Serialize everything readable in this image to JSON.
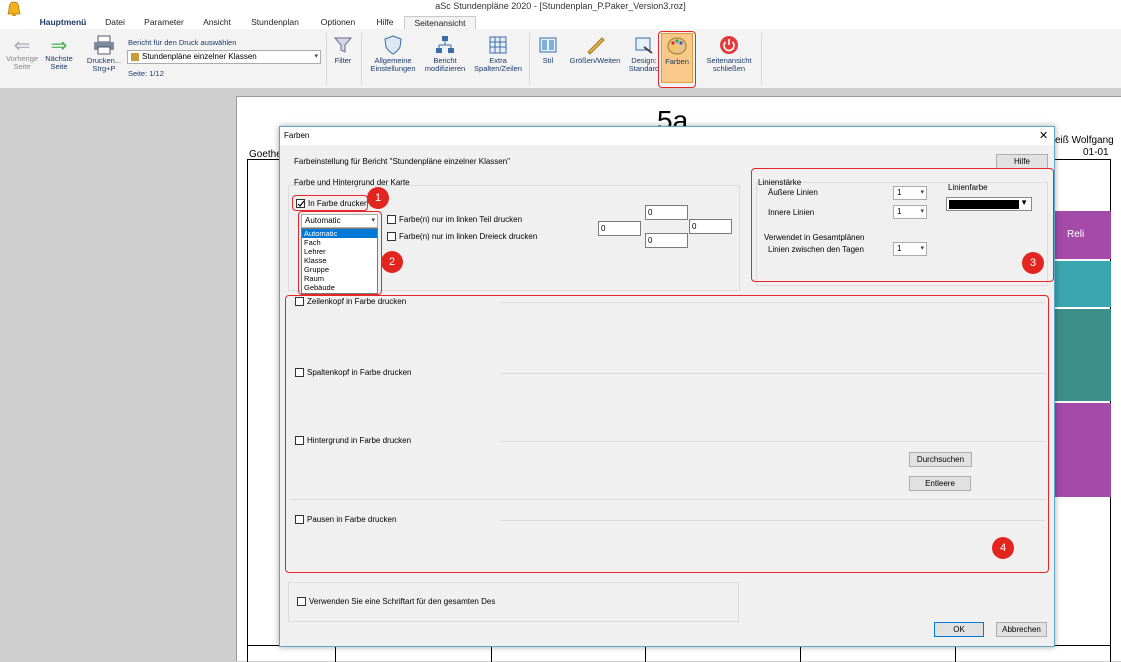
{
  "window": {
    "title": "aSc Stundenpläne 2020  - [Stundenplan_P.Paker_Version3.roz]"
  },
  "menu": {
    "tabs": [
      "Hauptmenü",
      "Datei",
      "Parameter",
      "Ansicht",
      "Stundenplan",
      "Optionen",
      "Hilfe",
      "Seitenansicht"
    ]
  },
  "ribbon": {
    "prev_label1": "Vorherige",
    "prev_label2": "Seite",
    "next_label1": "Nächste",
    "next_label2": "Seite",
    "print_label1": "Drucken...",
    "print_label2": "Strg+P",
    "report_caption": "Bericht für den Druck auswählen",
    "report_value": "Stundenpläne einzelner Klassen",
    "page_indicator": "Seite: 1/12",
    "filter": "Filter",
    "general1": "Allgemeine",
    "general2": "Einstellungen",
    "modify1": "Bericht",
    "modify2": "modifizieren",
    "extra1": "Extra",
    "extra2": "Spalten/Zeilen",
    "style": "Stil",
    "sizes": "Größen/Weiten",
    "design1": "Design:",
    "design2": "Standard",
    "colors": "Farben",
    "close1": "Seitenansicht",
    "close2": "schließen"
  },
  "page": {
    "heading": "5a",
    "left_text": "Goethe",
    "right_text": "eiß Wolfgang",
    "right_sub": "01-01",
    "cell_text": "Reli"
  },
  "dialog": {
    "title": "Farben",
    "close_symbol": "✕",
    "report_info": "Farbeinstellung für Bericht \"Stundenpläne einzelner Klassen\"",
    "help": "Hilfe",
    "group_card": "Farbe und Hintergrund der Karte",
    "print_color": "In Farbe drucken",
    "combo_value": "Automatic",
    "dropdown_options": [
      "Automatic",
      "Fach",
      "Lehrer",
      "Klasse",
      "Gruppe",
      "Raum",
      "Gebäude"
    ],
    "left_part": "Farbe(n) nur im linken Teil drucken",
    "left_triangle": "Farbe(n) nur im linken Dreieck drucken",
    "num_top": "0",
    "num_left": "0",
    "num_right": "0",
    "num_bottom": "0",
    "group_line": "Linienstärke",
    "outer_lines": "Äußere Linien",
    "outer_value": "1",
    "inner_lines": "Innere Linien",
    "inner_value": "1",
    "line_color": "Linienfarbe",
    "used_in": "Verwendet in Gesamtplänen",
    "between_days": "Linien zwischen den Tagen",
    "between_value": "1",
    "row_header": "Zeilenkopf in Farbe drucken",
    "col_header": "Spaltenkopf in Farbe drucken",
    "background": "Hintergrund in Farbe drucken",
    "browse": "Durchsuchen",
    "clear": "Entleere",
    "breaks": "Pausen in Farbe drucken",
    "font_all": "Verwenden Sie eine Schriftart für den gesamten Des",
    "ok": "OK",
    "cancel": "Abbrechen"
  },
  "badges": [
    "1",
    "2",
    "3",
    "4"
  ],
  "colors": {
    "highlight": "#e5262a",
    "badge": "#e2261f",
    "teal": "#3aa6b0",
    "purple": "#a44aa8",
    "dark_teal": "#3d8f8a",
    "selection": "#0078d7"
  }
}
